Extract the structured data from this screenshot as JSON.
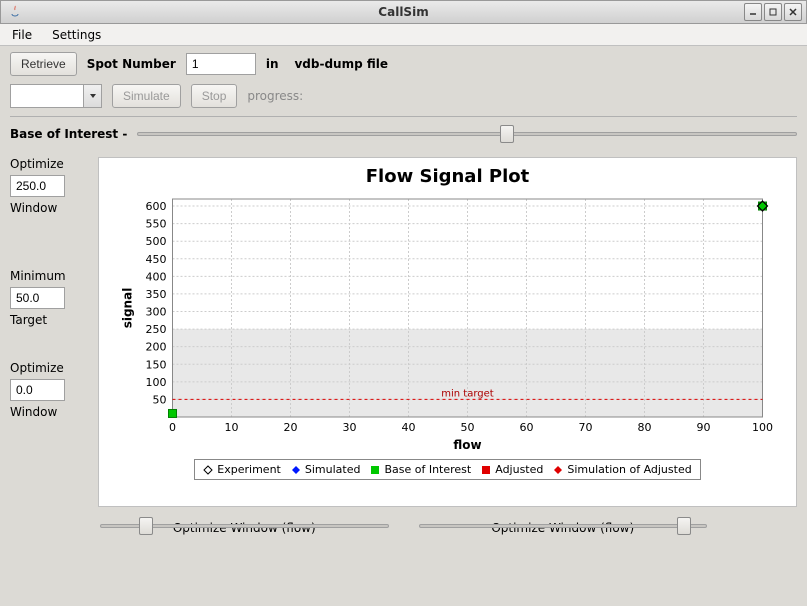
{
  "window": {
    "title": "CallSim"
  },
  "menubar": {
    "file": "File",
    "settings": "Settings"
  },
  "toolbar1": {
    "retrieve": "Retrieve",
    "spot_label": "Spot Number",
    "spot_value": "1",
    "in_label": "in",
    "file_label": "vdb-dump file"
  },
  "toolbar2": {
    "combo_value": "",
    "simulate": "Simulate",
    "stop": "Stop",
    "progress_label": "progress:"
  },
  "base_of_interest": {
    "label": "Base of Interest -",
    "slider_pos": 56
  },
  "side": {
    "optimize1_label": "Optimize",
    "optimize1_value": "250.0",
    "optimize1_sub": "Window",
    "minimum_label": "Minimum",
    "minimum_value": "50.0",
    "minimum_sub": "Target",
    "optimize2_label": "Optimize",
    "optimize2_value": "0.0",
    "optimize2_sub": "Window"
  },
  "chart_data": {
    "type": "scatter",
    "title": "Flow Signal Plot",
    "xlabel": "flow",
    "ylabel": "signal",
    "xlim": [
      0,
      100
    ],
    "ylim": [
      0,
      620
    ],
    "xticks": [
      0,
      10,
      20,
      30,
      40,
      50,
      60,
      70,
      80,
      90,
      100
    ],
    "yticks": [
      50,
      100,
      150,
      200,
      250,
      300,
      350,
      400,
      450,
      500,
      550,
      600
    ],
    "shaded_ymax": 250,
    "min_target": {
      "y": 50,
      "label": "min target"
    },
    "points": [
      {
        "x": 0,
        "y": 10,
        "series": "Base of Interest"
      },
      {
        "x": 100,
        "y": 600,
        "series": "Base of Interest"
      },
      {
        "x": 100,
        "y": 600,
        "series": "Experiment"
      }
    ],
    "legend": [
      {
        "name": "Experiment",
        "marker": "diamond-open",
        "color": "#000"
      },
      {
        "name": "Simulated",
        "marker": "diamond-fill",
        "color": "#0018ff"
      },
      {
        "name": "Base of Interest",
        "marker": "square-fill",
        "color": "#00c800"
      },
      {
        "name": "Adjusted",
        "marker": "square-fill",
        "color": "#e00000"
      },
      {
        "name": "Simulation of Adjusted",
        "marker": "diamond-fill",
        "color": "#e00000"
      }
    ]
  },
  "bottom_sliders": {
    "left_label": "Optimize Window (flow)",
    "left_pos": 16,
    "right_label": "Optimize Window (flow)",
    "right_pos": 92
  }
}
